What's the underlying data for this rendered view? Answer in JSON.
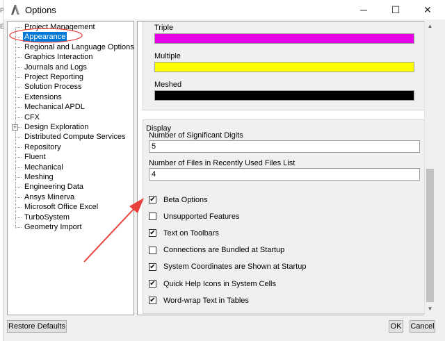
{
  "window": {
    "title": "Options",
    "minimize_glyph": "─",
    "maximize_glyph": "☐",
    "close_glyph": "✕",
    "background_edge_chars": [
      "P",
      "E"
    ]
  },
  "tree": {
    "items": [
      {
        "label": "Project Management"
      },
      {
        "label": "Appearance",
        "selected": true
      },
      {
        "label": "Regional and Language Options"
      },
      {
        "label": "Graphics Interaction"
      },
      {
        "label": "Journals and Logs"
      },
      {
        "label": "Project Reporting"
      },
      {
        "label": "Solution Process"
      },
      {
        "label": "Extensions"
      },
      {
        "label": "Mechanical APDL"
      },
      {
        "label": "CFX"
      },
      {
        "label": "Design Exploration",
        "expandable": true,
        "expander_glyph": "+"
      },
      {
        "label": "Distributed Compute Services"
      },
      {
        "label": "Repository"
      },
      {
        "label": "Fluent"
      },
      {
        "label": "Mechanical"
      },
      {
        "label": "Meshing"
      },
      {
        "label": "Engineering Data"
      },
      {
        "label": "Ansys Minerva"
      },
      {
        "label": "Microsoft Office Excel"
      },
      {
        "label": "TurboSystem"
      },
      {
        "label": "Geometry Import"
      }
    ]
  },
  "colors": [
    {
      "label": "Triple",
      "color": "#e600e6"
    },
    {
      "label": "Multiple",
      "color": "#ffff00"
    },
    {
      "label": "Meshed",
      "color": "#000000"
    }
  ],
  "display": {
    "title": "Display",
    "sig_digits_label": "Number of Significant Digits",
    "sig_digits_value": "5",
    "recent_files_label": "Number of Files in Recently Used Files List",
    "recent_files_value": "4",
    "checkboxes": [
      {
        "label": "Beta Options",
        "checked": true
      },
      {
        "label": "Unsupported Features",
        "checked": false
      },
      {
        "label": "Text on Toolbars",
        "checked": true
      },
      {
        "label": "Connections are Bundled at Startup",
        "checked": false
      },
      {
        "label": "System Coordinates are Shown at Startup",
        "checked": true
      },
      {
        "label": "Quick Help Icons in System Cells",
        "checked": true
      },
      {
        "label": "Word-wrap Text in Tables",
        "checked": true
      }
    ]
  },
  "scrollbar": {
    "up_glyph": "▲",
    "down_glyph": "▼"
  },
  "buttons": {
    "restore": "Restore Defaults",
    "ok": "OK",
    "cancel": "Cancel"
  },
  "annotation_color": "#e8403a"
}
